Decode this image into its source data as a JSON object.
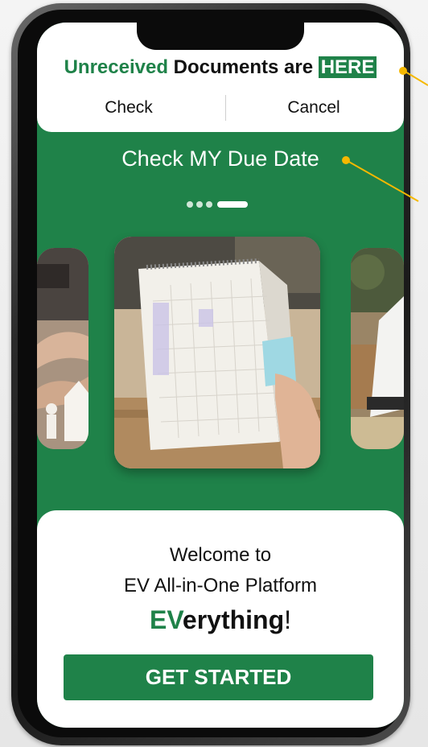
{
  "doc_banner": {
    "title_green": "Unreceived",
    "title_mid": "Documents are",
    "title_highlight": "HERE",
    "check_label": "Check",
    "cancel_label": "Cancel"
  },
  "carousel": {
    "title": "Check MY Due Date",
    "page_count": 4,
    "active_page": 4,
    "slides": [
      {
        "image": "family-paper-cutout-hands-photo"
      },
      {
        "image": "desk-calendar-sticky-note-photo"
      },
      {
        "image": "clipboard-on-desk-photo"
      }
    ]
  },
  "welcome": {
    "line1": "Welcome to",
    "line2": "EV All-in-One Platform",
    "brand_accent": "EV",
    "brand_rest": "erything",
    "brand_excl": "!",
    "cta_label": "GET STARTED"
  },
  "colors": {
    "brand_green": "#1f8249",
    "callout_yellow": "#f5b800",
    "white": "#ffffff"
  }
}
